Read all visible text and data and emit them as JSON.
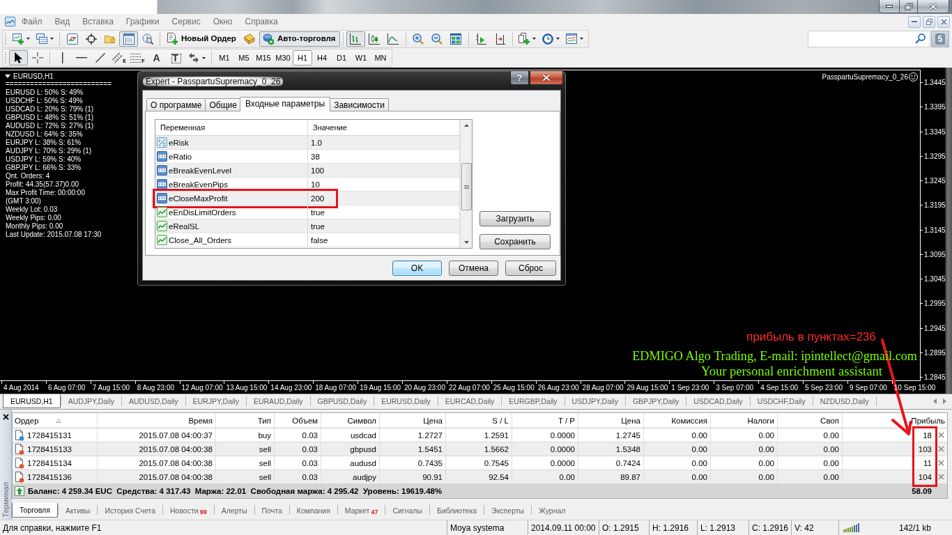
{
  "menu": [
    "Файл",
    "Вид",
    "Вставка",
    "Графики",
    "Сервис",
    "Окно",
    "Справка"
  ],
  "toolbar": {
    "groups": [
      [
        {
          "pressed": false
        },
        {
          "pressed": false
        }
      ],
      [
        {
          "pressed": false
        },
        {
          "pressed": false
        },
        {
          "pressed": false
        },
        {
          "pressed": true
        },
        {
          "pressed": false
        }
      ],
      [
        {
          "label": "Новый Ордер",
          "pressed": false
        },
        {
          "pressed": false
        },
        {
          "label": "Авто-торговля",
          "pressed": true
        }
      ],
      [
        {
          "pressed": true
        },
        {
          "pressed": false
        },
        {
          "pressed": false
        }
      ],
      [
        {
          "pressed": false
        },
        {
          "pressed": false
        },
        {
          "pressed": false
        }
      ],
      [
        {
          "pressed": false
        },
        {
          "pressed": false
        }
      ],
      [
        {
          "pressed": false
        },
        {
          "pressed": false
        },
        {
          "pressed": false
        }
      ]
    ]
  },
  "drawing_toolbar": {
    "groups": [
      [
        {
          "selected": true
        },
        {
          "selected": false
        }
      ],
      [
        {
          "selected": false
        },
        {
          "selected": false
        },
        {
          "selected": false
        },
        {
          "badge": "E",
          "selected": false
        },
        {
          "badge": "F",
          "selected": false
        },
        {
          "label": "A",
          "selected": false
        },
        {
          "label": "T",
          "selected": false
        },
        {
          "selected": false
        }
      ]
    ]
  },
  "timeframes": [
    {
      "label": "M1",
      "selected": false
    },
    {
      "label": "M5",
      "selected": false
    },
    {
      "label": "M15",
      "selected": false
    },
    {
      "label": "M30",
      "selected": false
    },
    {
      "label": "H1",
      "selected": true
    },
    {
      "label": "H4",
      "selected": false
    },
    {
      "label": "D1",
      "selected": false
    },
    {
      "label": "W1",
      "selected": false
    },
    {
      "label": "MN",
      "selected": false
    }
  ],
  "notifications": {
    "count": "5"
  },
  "chart": {
    "title": "EURUSD,H1",
    "info_lines": [
      "==========================",
      "EURUSD L: 50% S: 49%",
      "USDCHF L: 50% S: 49%",
      "USDCAD L: 20% S: 79% (1)",
      "GBPUSD L: 48% S: 51% (1)",
      "AUDUSD L: 72% S: 27% (1)",
      "NZDUSD L: 64% S: 35%",
      "EURJPY L: 38% S: 61%",
      "AUDJPY L: 70% S: 29% (1)",
      "USDJPY L: 59% S: 40%",
      "GBPJPY L: 66% S: 33%",
      "Qnt. Orders: 4",
      "Profit: 44.35(57.37)0.00",
      "Max Profit Time: 00:00:00",
      "(GMT 3:00)",
      "Weekly Lot: 0.03",
      "Weekly Pips: 0.00",
      "Monthly Pips: 0.00",
      "Last Update: 2015.07.08 17:30"
    ],
    "expert": "PasspartuSupremacy_0_26",
    "price_axis": [
      "1.3445",
      "1.3395",
      "1.3345",
      "1.3295",
      "1.3245",
      "1.3195",
      "1.3145",
      "1.3095",
      "1.3045",
      "1.2995",
      "1.2945",
      "1.2895",
      "1.2845"
    ],
    "time_axis": [
      "4 Aug 2014",
      "6 Aug 07:00",
      "7 Aug 15:00",
      "8 Aug 23:00",
      "12 Aug 07:00",
      "13 Aug 15:00",
      "14 Aug 23:00",
      "18 Aug 07:00",
      "19 Aug 15:00",
      "20 Aug 23:00",
      "22 Aug 07:00",
      "25 Aug 15:00",
      "26 Aug 23:00",
      "28 Aug 07:00",
      "29 Aug 15:00",
      "1 Sep 23:00",
      "3 Sep 07:00",
      "4 Sep 15:00",
      "5 Sep 23:00",
      "9 Sep 07:00",
      "10 Sep 15:00"
    ],
    "profit_note": "прибыль в пунктах=236",
    "labels": [
      "EDMIGO Algo Trading, E-mail: ipintellect@gmail.com",
      "Your personal enrichment assistant"
    ]
  },
  "dialog": {
    "title": "Expert - PasspartuSupremacy_0_26",
    "help": "?",
    "tabs": [
      {
        "label": "О программе",
        "selected": false
      },
      {
        "label": "Общие",
        "selected": false
      },
      {
        "label": "Входные параметры",
        "selected": true
      },
      {
        "label": "Зависимости",
        "selected": false
      }
    ],
    "columns": [
      "Переменная",
      "Значение"
    ],
    "params": [
      {
        "kind": "double",
        "name": "eRisk",
        "value": "1.0",
        "highlighted": false
      },
      {
        "kind": "int",
        "name": "eRatio",
        "value": "38",
        "highlighted": false
      },
      {
        "kind": "int",
        "name": "eBreakEvenLevel",
        "value": "100",
        "highlighted": false
      },
      {
        "kind": "int",
        "name": "eBreakEvenPips",
        "value": "10",
        "highlighted": false
      },
      {
        "kind": "int",
        "name": "eCloseMaxProfit",
        "value": "200",
        "highlighted": true
      },
      {
        "kind": "bool",
        "name": "eEnDisLimitOrders",
        "value": "true",
        "highlighted": false
      },
      {
        "kind": "bool",
        "name": "eRealSL",
        "value": "true",
        "highlighted": false
      },
      {
        "kind": "bool",
        "name": "Close_All_Orders",
        "value": "false",
        "highlighted": false
      }
    ],
    "side_buttons": [
      "Загрузить",
      "Сохранить"
    ],
    "buttons": [
      {
        "label": "OK",
        "default": true
      },
      {
        "label": "Отмена",
        "default": false
      },
      {
        "label": "Сброс",
        "default": false
      }
    ]
  },
  "chart_tabs": [
    {
      "label": "EURUSD,H1",
      "selected": true
    },
    {
      "label": "AUDJPY,Daily",
      "selected": false
    },
    {
      "label": "AUDUSD,Daily",
      "selected": false
    },
    {
      "label": "EURJPY,Daily",
      "selected": false
    },
    {
      "label": "EURAUD,Daily",
      "selected": false
    },
    {
      "label": "GBPUSD,Daily",
      "selected": false
    },
    {
      "label": "EURUSD,Daily",
      "selected": false
    },
    {
      "label": "EURCAD,Daily",
      "selected": false
    },
    {
      "label": "EURGBP,Daily",
      "selected": false
    },
    {
      "label": "USDJPY,Daily",
      "selected": false
    },
    {
      "label": "GBPJPY,Daily",
      "selected": false
    },
    {
      "label": "USDCAD,Daily",
      "selected": false
    },
    {
      "label": "USDCHF,Daily",
      "selected": false
    },
    {
      "label": "NZDUSD,Daily",
      "selected": false
    }
  ],
  "terminal": {
    "title": "Терминал",
    "columns": [
      {
        "label": "Ордер",
        "sorted": true
      },
      {
        "label": "Время",
        "sorted": false
      },
      {
        "label": "Тип",
        "sorted": false
      },
      {
        "label": "Объем",
        "sorted": false
      },
      {
        "label": "Символ",
        "sorted": false
      },
      {
        "label": "Цена",
        "sorted": false
      },
      {
        "label": "S / L",
        "sorted": false
      },
      {
        "label": "T / P",
        "sorted": false
      },
      {
        "label": "Цена",
        "sorted": false
      },
      {
        "label": "Комиссия",
        "sorted": false
      },
      {
        "label": "Налоги",
        "sorted": false
      },
      {
        "label": "Своп",
        "sorted": false
      },
      {
        "label": "Прибыль",
        "sorted": false
      }
    ],
    "orders": [
      {
        "color": "#2f8ce0",
        "cells": [
          "1728415131",
          "2015.07.08 04:00:37",
          "buy",
          "0.03",
          "usdcad",
          "1.2727",
          "1.2591",
          "0.0000",
          "1.2745",
          "0.00",
          "0.00",
          "0.00",
          "18"
        ]
      },
      {
        "color": "#e4502a",
        "cells": [
          "1728415133",
          "2015.07.08 04:00:38",
          "sell",
          "0.03",
          "gbpusd",
          "1.5451",
          "1.5662",
          "0.0000",
          "1.5348",
          "0.00",
          "0.00",
          "0.00",
          "103"
        ]
      },
      {
        "color": "#e4502a",
        "cells": [
          "1728415134",
          "2015.07.08 04:00:38",
          "sell",
          "0.03",
          "audusd",
          "0.7435",
          "0.7545",
          "0.0000",
          "0.7424",
          "0.00",
          "0.00",
          "0.00",
          "11"
        ]
      },
      {
        "color": "#e4502a",
        "cells": [
          "1728415136",
          "2015.07.08 04:00:38",
          "sell",
          "0.03",
          "audjpy",
          "90.91",
          "92.54",
          "0.00",
          "89.87",
          "0.00",
          "0.00",
          "0.00",
          "104"
        ]
      }
    ],
    "summary": "Баланс: 4 259.34 EUC  Средства: 4 317.43  Маржа: 22.01  Свободная маржа: 4 295.42  Уровень: 19619.48%",
    "total_profit": "58.09",
    "tabs": [
      {
        "label": "Торговля",
        "selected": true
      },
      {
        "label": "Активы",
        "selected": false
      },
      {
        "label": "История Счета",
        "selected": false
      },
      {
        "label": "Новости",
        "badge": "99",
        "selected": false
      },
      {
        "label": "Алерты",
        "selected": false
      },
      {
        "label": "Почта",
        "selected": false
      },
      {
        "label": "Компания",
        "selected": false
      },
      {
        "label": "Маркет",
        "badge": "47",
        "selected": false
      },
      {
        "label": "Сигналы",
        "selected": false
      },
      {
        "label": "Библиотека",
        "selected": false
      },
      {
        "label": "Эксперты",
        "selected": false
      },
      {
        "label": "Журнал",
        "selected": false
      }
    ]
  },
  "status_bar": [
    {
      "kind": "text",
      "text": "Для справки, нажмите F1"
    },
    {
      "kind": "text",
      "text": "Moya systema"
    },
    {
      "kind": "text",
      "text": "2014.09.11 00:00"
    },
    {
      "kind": "text",
      "text": "O: 1.2915"
    },
    {
      "kind": "text",
      "text": "H: 1.2916"
    },
    {
      "kind": "text",
      "text": "L: 1.2913"
    },
    {
      "kind": "text",
      "text": "C: 1.2916"
    },
    {
      "kind": "text",
      "text": "V: 42"
    },
    {
      "kind": "connection",
      "text": "142/1 kb"
    }
  ]
}
